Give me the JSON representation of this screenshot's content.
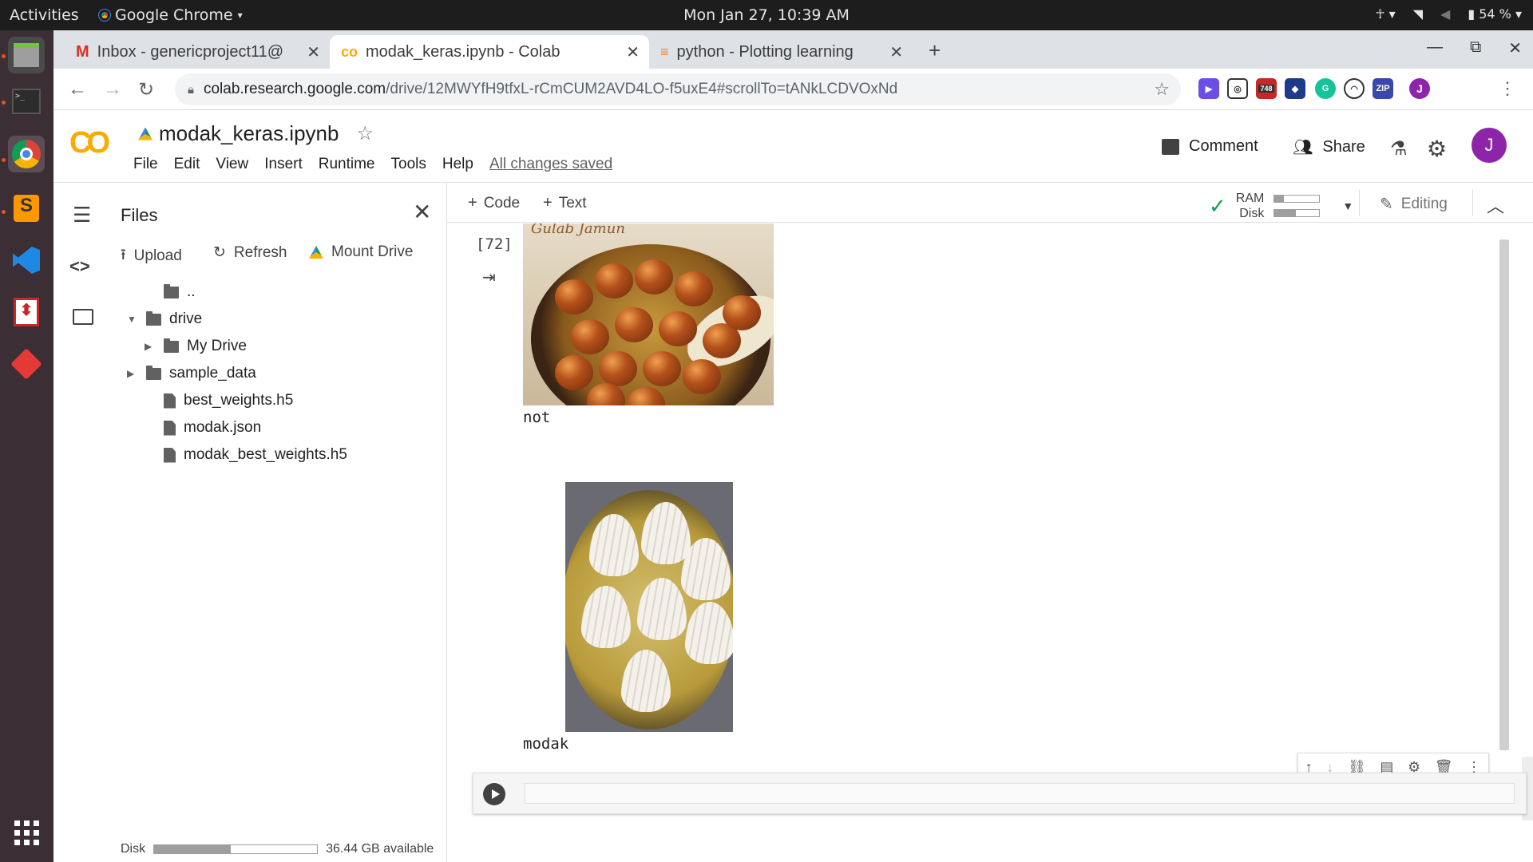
{
  "topbar": {
    "activities": "Activities",
    "app_name": "Google Chrome",
    "clock": "Mon Jan 27, 10:39 AM",
    "battery": "54 %"
  },
  "tabs": [
    {
      "title": "Inbox - genericproject11@",
      "icon": "gmail-icon"
    },
    {
      "title": "modak_keras.ipynb - Colab",
      "icon": "colab-icon"
    },
    {
      "title": "python - Plotting learning",
      "icon": "stackoverflow-icon"
    }
  ],
  "address": {
    "url_host": "colab.research.google.com",
    "url_path": "/drive/12MWYfH9tfxL-rCmCUM2AVD4LO-f5uxE4#scrollTo=tANkLCDVOxNd",
    "ext_badge": "748",
    "avatar_letter": "J"
  },
  "colab": {
    "logo": "CO",
    "filename": "modak_keras.ipynb",
    "menu": [
      "File",
      "Edit",
      "View",
      "Insert",
      "Runtime",
      "Tools",
      "Help"
    ],
    "saved": "All changes saved",
    "comment": "Comment",
    "share": "Share",
    "avatar_letter": "J"
  },
  "sidebar": {
    "title": "Files",
    "upload": "Upload",
    "refresh": "Refresh",
    "mount": "Mount Drive",
    "parent": "..",
    "items": [
      "drive",
      "My Drive",
      "sample_data",
      "best_weights.h5",
      "modak.json",
      "modak_best_weights.h5"
    ],
    "disk_label": "Disk",
    "disk_fraction": 0.47,
    "disk_avail": "36.44 GB available"
  },
  "toolbar": {
    "code": "Code",
    "text": "Text",
    "ram": "RAM",
    "disk": "Disk",
    "ram_fraction": 0.2,
    "disk_fraction": 0.47,
    "editing": "Editing"
  },
  "output": {
    "exec_count": "[72]",
    "img1_caption": "Gulab Jamun",
    "label1": "not",
    "label2": "modak"
  },
  "colors": {
    "accent_orange": "#f9ab00",
    "avatar": "#8e24aa",
    "check": "#0f9d58",
    "dock_bg": "#3b2e35"
  }
}
